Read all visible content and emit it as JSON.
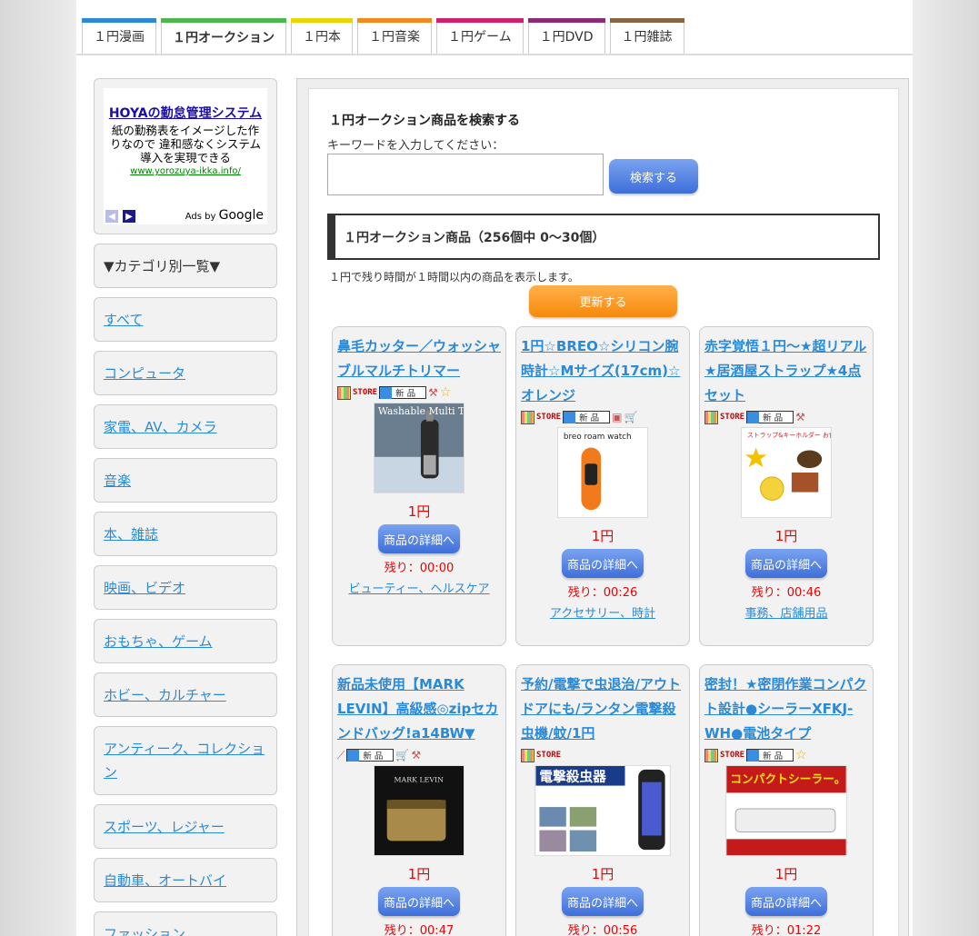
{
  "tabs": [
    {
      "label": "１円漫画",
      "color": "#2a8ad8",
      "active": false
    },
    {
      "label": "１円オークション",
      "color": "#4cb84c",
      "active": true
    },
    {
      "label": "１円本",
      "color": "#e8d400",
      "active": false
    },
    {
      "label": "１円音楽",
      "color": "#f08a1c",
      "active": false
    },
    {
      "label": "１円ゲーム",
      "color": "#d0206a",
      "active": false
    },
    {
      "label": "１円DVD",
      "color": "#8a2a78",
      "active": false
    },
    {
      "label": "１円雑誌",
      "color": "#8a6440",
      "active": false
    }
  ],
  "ad": {
    "title": "HOYAの勤怠管理システム",
    "body": "紙の勤務表をイメージした作りなので 違和感なくシステム導入を実現できる",
    "url": "www.yorozuya-ikka.info/",
    "by": "Ads by",
    "brand": "Google"
  },
  "sidebar": {
    "heading": "▼カテゴリ別一覧▼",
    "items": [
      "すべて",
      "コンピュータ",
      "家電、AV、カメラ",
      "音楽",
      "本、雑誌",
      "映画、ビデオ",
      "おもちゃ、ゲーム",
      "ホビー、カルチャー",
      "アンティーク、コレクション",
      "スポーツ、レジャー",
      "自動車、オートバイ",
      "ファッション"
    ]
  },
  "search": {
    "title": "１円オークション商品を検索する",
    "label": "キーワードを入力してください：",
    "value": "",
    "button": "検索する"
  },
  "results": {
    "header": "１円オークション商品（256個中 0〜30個）",
    "note": "１円で残り時間が１時間以内の商品を表示します。",
    "refresh": "更新する",
    "store_label": "STORE",
    "new_label": "新品",
    "detail_label": "商品の詳細へ",
    "items": [
      {
        "title": "鼻毛カッター／ウォッシャブルマルチトリマー",
        "price": "1円",
        "remain": "残り：00:00",
        "category": "ビューティー、ヘルスケア",
        "thumb_text": "Washable Multi Trimmer"
      },
      {
        "title": "1円☆BREO☆シリコン腕時計☆Mサイズ(17cm)☆オレンジ",
        "price": "1円",
        "remain": "残り：00:26",
        "category": "アクセサリー、時計",
        "thumb_text": "breo roam watch"
      },
      {
        "title": "赤字覚悟１円〜★超リアル★居酒屋ストラップ★4点セット",
        "price": "1円",
        "remain": "残り：00:46",
        "category": "事務、店舗用品",
        "thumb_text": "ストラップ&キーホルダー お食事セット"
      },
      {
        "title": "新品未使用【MARK LEVIN】高級感◎zipセカンドバッグ!a14BW▼",
        "price": "1円",
        "remain": "残り：00:47",
        "category": "",
        "thumb_text": "MARK LEVIN"
      },
      {
        "title": "予約/電撃で虫退治/アウトドアにも/ランタン電撃殺虫機/蚊/1円",
        "price": "1円",
        "remain": "残り：00:56",
        "category": "",
        "thumb_text": "電撃殺虫器"
      },
      {
        "title": "密封！★密閉作業コンパクト設計●シーラーXFKJ-WH●電池タイプ",
        "price": "1円",
        "remain": "残り：01:22",
        "category": "",
        "thumb_text": "コンパクトシーラー。"
      }
    ]
  }
}
